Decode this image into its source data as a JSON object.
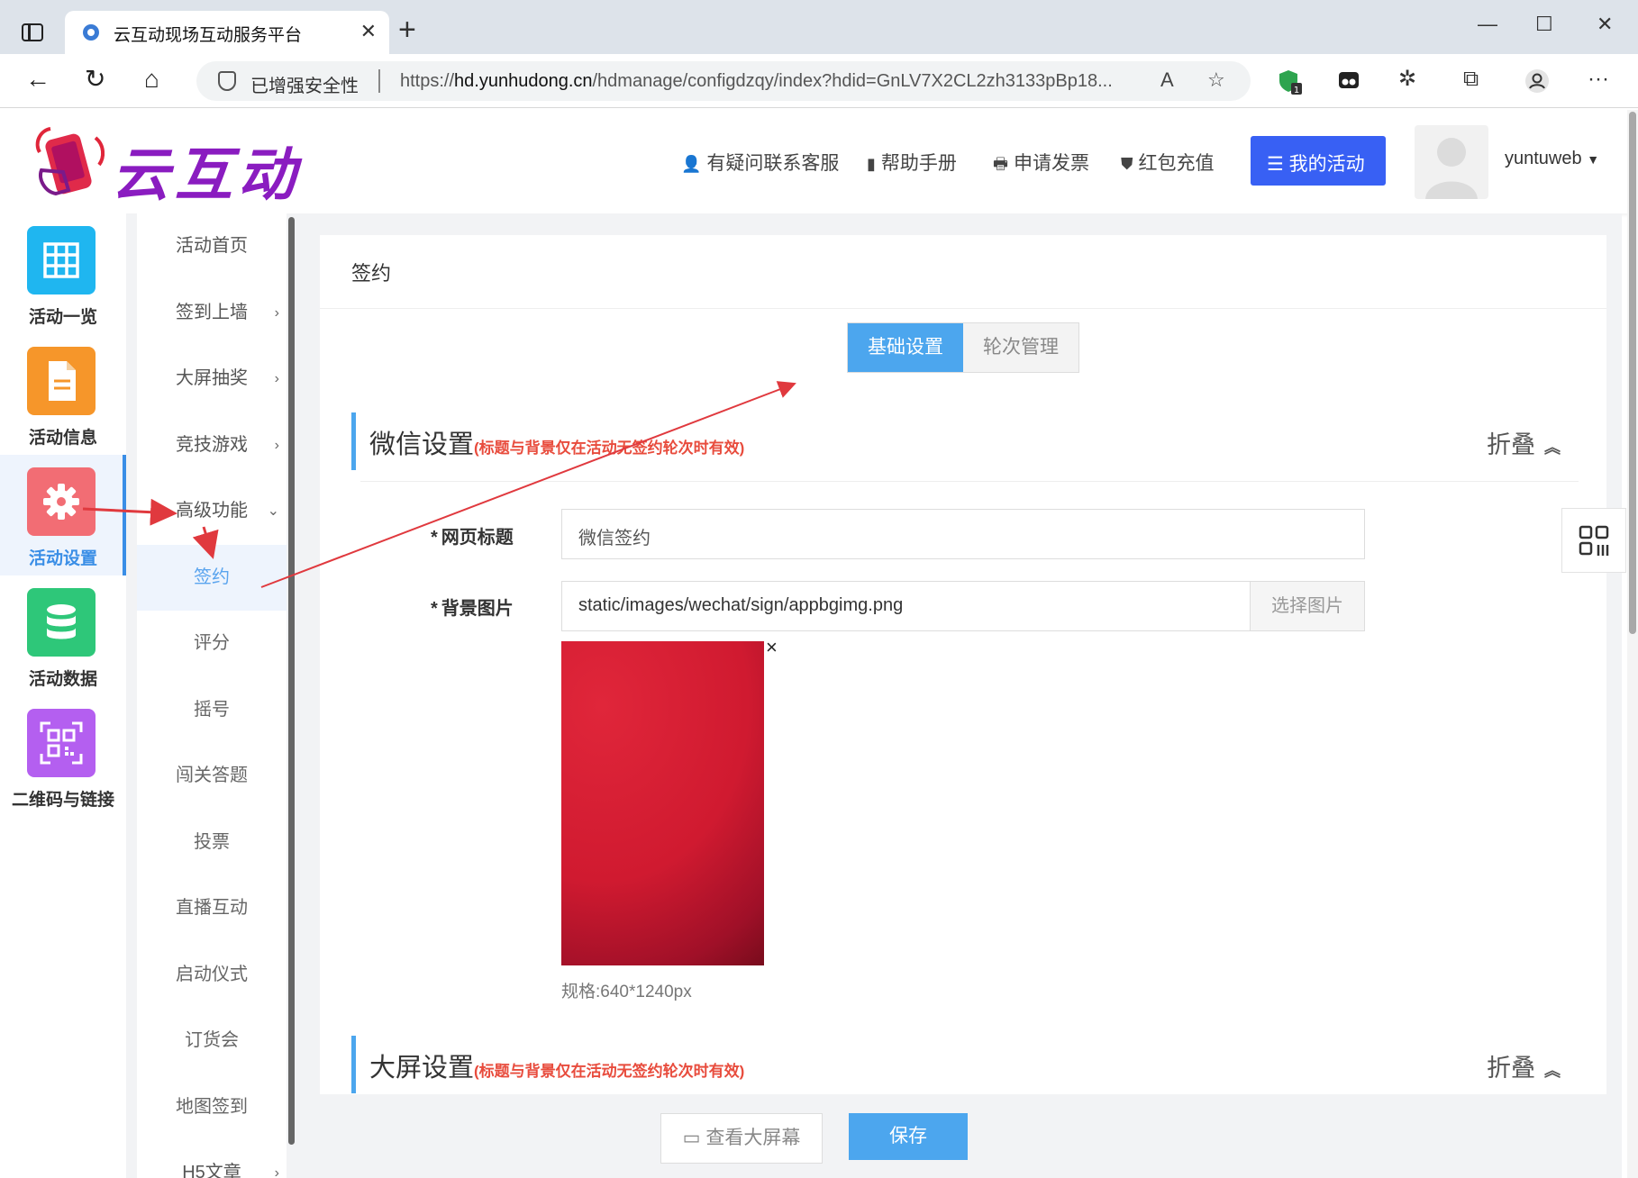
{
  "browser": {
    "tab_title": "云互动现场互动服务平台",
    "tab_close": "✕",
    "new_tab": "+",
    "security_label": "已增强安全性",
    "url_prefix": "https://",
    "url_host": "hd.yunhudong.cn",
    "url_path": "/hdmanage/configdzqy/index?hdid=GnLV7X2CL2zh3133pBp18...",
    "extension_badge": "1"
  },
  "header": {
    "logo_text": "云互动",
    "links": [
      {
        "icon": "person-add-icon",
        "glyph": "👤",
        "label": "有疑问联系客服"
      },
      {
        "icon": "book-icon",
        "glyph": "▮",
        "label": "帮助手册"
      },
      {
        "icon": "printer-icon",
        "glyph": "🖶",
        "label": "申请发票"
      },
      {
        "icon": "shield-check-icon",
        "glyph": "⛊",
        "label": "红包充值"
      }
    ],
    "my_activity": "我的活动",
    "username": "yuntuweb"
  },
  "rail": [
    {
      "label": "活动一览",
      "icon": "grid-icon",
      "color": "#1fb6f0"
    },
    {
      "label": "活动信息",
      "icon": "document-icon",
      "color": "#f6962a"
    },
    {
      "label": "活动设置",
      "icon": "gear-icon",
      "color": "#f26d74",
      "active": true
    },
    {
      "label": "活动数据",
      "icon": "database-icon",
      "color": "#2ec779"
    },
    {
      "label": "二维码与链接",
      "icon": "qrcode-icon",
      "color": "#b45ff0"
    }
  ],
  "submenu": [
    {
      "label": "活动首页",
      "arrow": ""
    },
    {
      "label": "签到上墙",
      "arrow": "›"
    },
    {
      "label": "大屏抽奖",
      "arrow": "›"
    },
    {
      "label": "竞技游戏",
      "arrow": "›"
    },
    {
      "label": "高级功能",
      "arrow": "⌄"
    },
    {
      "label": "签约",
      "arrow": "",
      "active": true,
      "indent": true
    },
    {
      "label": "评分",
      "arrow": "",
      "indent": true
    },
    {
      "label": "摇号",
      "arrow": "",
      "indent": true
    },
    {
      "label": "闯关答题",
      "arrow": "",
      "indent": true
    },
    {
      "label": "投票",
      "arrow": "",
      "indent": true
    },
    {
      "label": "直播互动",
      "arrow": "",
      "indent": true
    },
    {
      "label": "启动仪式",
      "arrow": "",
      "indent": true
    },
    {
      "label": "订货会",
      "arrow": "",
      "indent": true
    },
    {
      "label": "地图签到",
      "arrow": "",
      "indent": true
    },
    {
      "label": "H5文章",
      "arrow": "›"
    }
  ],
  "page": {
    "title": "签约",
    "tabs": [
      "基础设置",
      "轮次管理"
    ],
    "wechat_section": {
      "title": "微信设置",
      "note": "(标题与背景仅在活动无签约轮次时有效)",
      "fold": "折叠"
    },
    "fields": {
      "page_title_label": "网页标题",
      "page_title_value": "微信签约",
      "bg_label": "背景图片",
      "bg_value": "static/images/wechat/sign/appbgimg.png",
      "choose_image": "选择图片",
      "remove": "×",
      "spec": "规格:640*1240px"
    },
    "screen_section": {
      "title": "大屏设置",
      "note": "(标题与背景仅在活动无签约轮次时有效)",
      "fold": "折叠"
    },
    "footer": {
      "view_screen": "查看大屏幕",
      "save": "保存"
    }
  },
  "colors": {
    "accent": "#4ca6ee",
    "brand_button": "#3860f4",
    "annotation": "#e0393e"
  }
}
